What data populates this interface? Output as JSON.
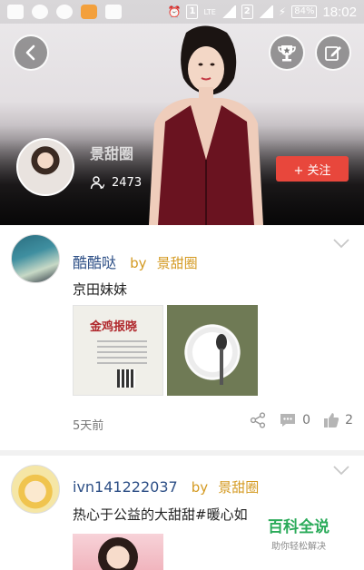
{
  "status_bar": {
    "time": "18:02",
    "battery": "84%",
    "sim1": "1",
    "sim2": "2",
    "network": "LTE"
  },
  "header": {
    "group_name": "景甜圈",
    "member_count": "2473",
    "follow_label": "+ 关注"
  },
  "posts": [
    {
      "username": "酷酷哒",
      "by": "by",
      "group": "景甜圈",
      "content": "京田妹妹",
      "image_titles": [
        "金鸡报晓"
      ],
      "time": "5天前",
      "comments": "0",
      "likes": "2"
    },
    {
      "username": "ivn141222037",
      "by": "by",
      "group": "景甜圈",
      "content": "热心于公益的大甜甜#暖心如"
    }
  ],
  "watermark": {
    "main": "百科全说",
    "sub": "助你轻松解决"
  },
  "colors": {
    "follow_button": "#e8473c",
    "username": "#2d4f86",
    "group_link": "#d49a22",
    "watermark": "#2bab5a"
  }
}
